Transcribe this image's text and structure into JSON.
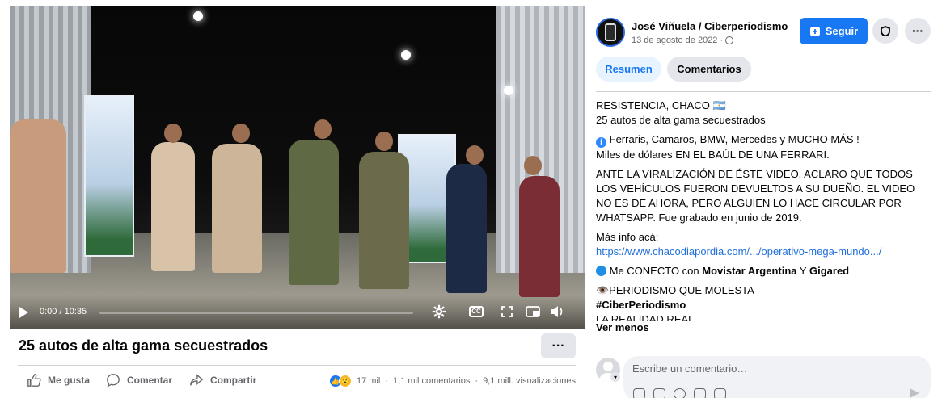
{
  "video": {
    "time": "0:00 / 10:35",
    "progress_percent": 0,
    "title": "25 autos de alta gama secuestrados",
    "more_label": "···"
  },
  "actions": {
    "like_label": "Me gusta",
    "comment_label": "Comentar",
    "share_label": "Compartir"
  },
  "stats": {
    "reactions": "17 mil",
    "separator1": "·",
    "comments": "1,1 mil comentarios",
    "separator2": "·",
    "views": "9,1 mill. visualizaciones"
  },
  "post": {
    "author": "José Viñuela / Ciberperiodismo",
    "date": "13 de agosto de 2022 ·",
    "follow_label": "Seguir",
    "more_label": "···"
  },
  "tabs": [
    {
      "label": "Resumen",
      "active": true
    },
    {
      "label": "Comentarios",
      "active": false
    }
  ],
  "body": {
    "line1": "RESISTENCIA, CHACO 🇦🇷",
    "line2": "25 autos de alta gama secuestrados",
    "line3": "Ferraris, Camaros, BMW, Mercedes y MUCHO MÁS !",
    "line4": "Miles de dólares EN EL BAÚL DE UNA FERRARI.",
    "para": "ANTE LA VIRALIZACIÓN DE ÉSTE VIDEO, ACLARO QUE TODOS LOS VEHÍCULOS FUERON DEVUELTOS A SU DUEÑO. EL VIDEO NO ES DE AHORA, PERO ALGUIEN LO HACE CIRCULAR POR WHATSAPP. Fue grabado en junio de 2019.",
    "more_info": "Más info acá:",
    "link": "https://www.chacodiapordia.com/.../operativo-mega-mundo.../",
    "connect_prefix": "Me CONECTO con",
    "connect_a": "Movistar Argentina",
    "connect_and": "Y",
    "connect_b": "Gigared",
    "tagline": "👁️PERIODISMO QUE MOLESTA",
    "hashtag": "#CiberPeriodismo",
    "truncated": "LA REALIDAD REAL",
    "see_less": "Ver menos"
  },
  "comment": {
    "placeholder": "Escribe un comentario…"
  },
  "colors": {
    "accent": "#1877f2",
    "link": "#216fdb",
    "muted": "#65676b"
  }
}
